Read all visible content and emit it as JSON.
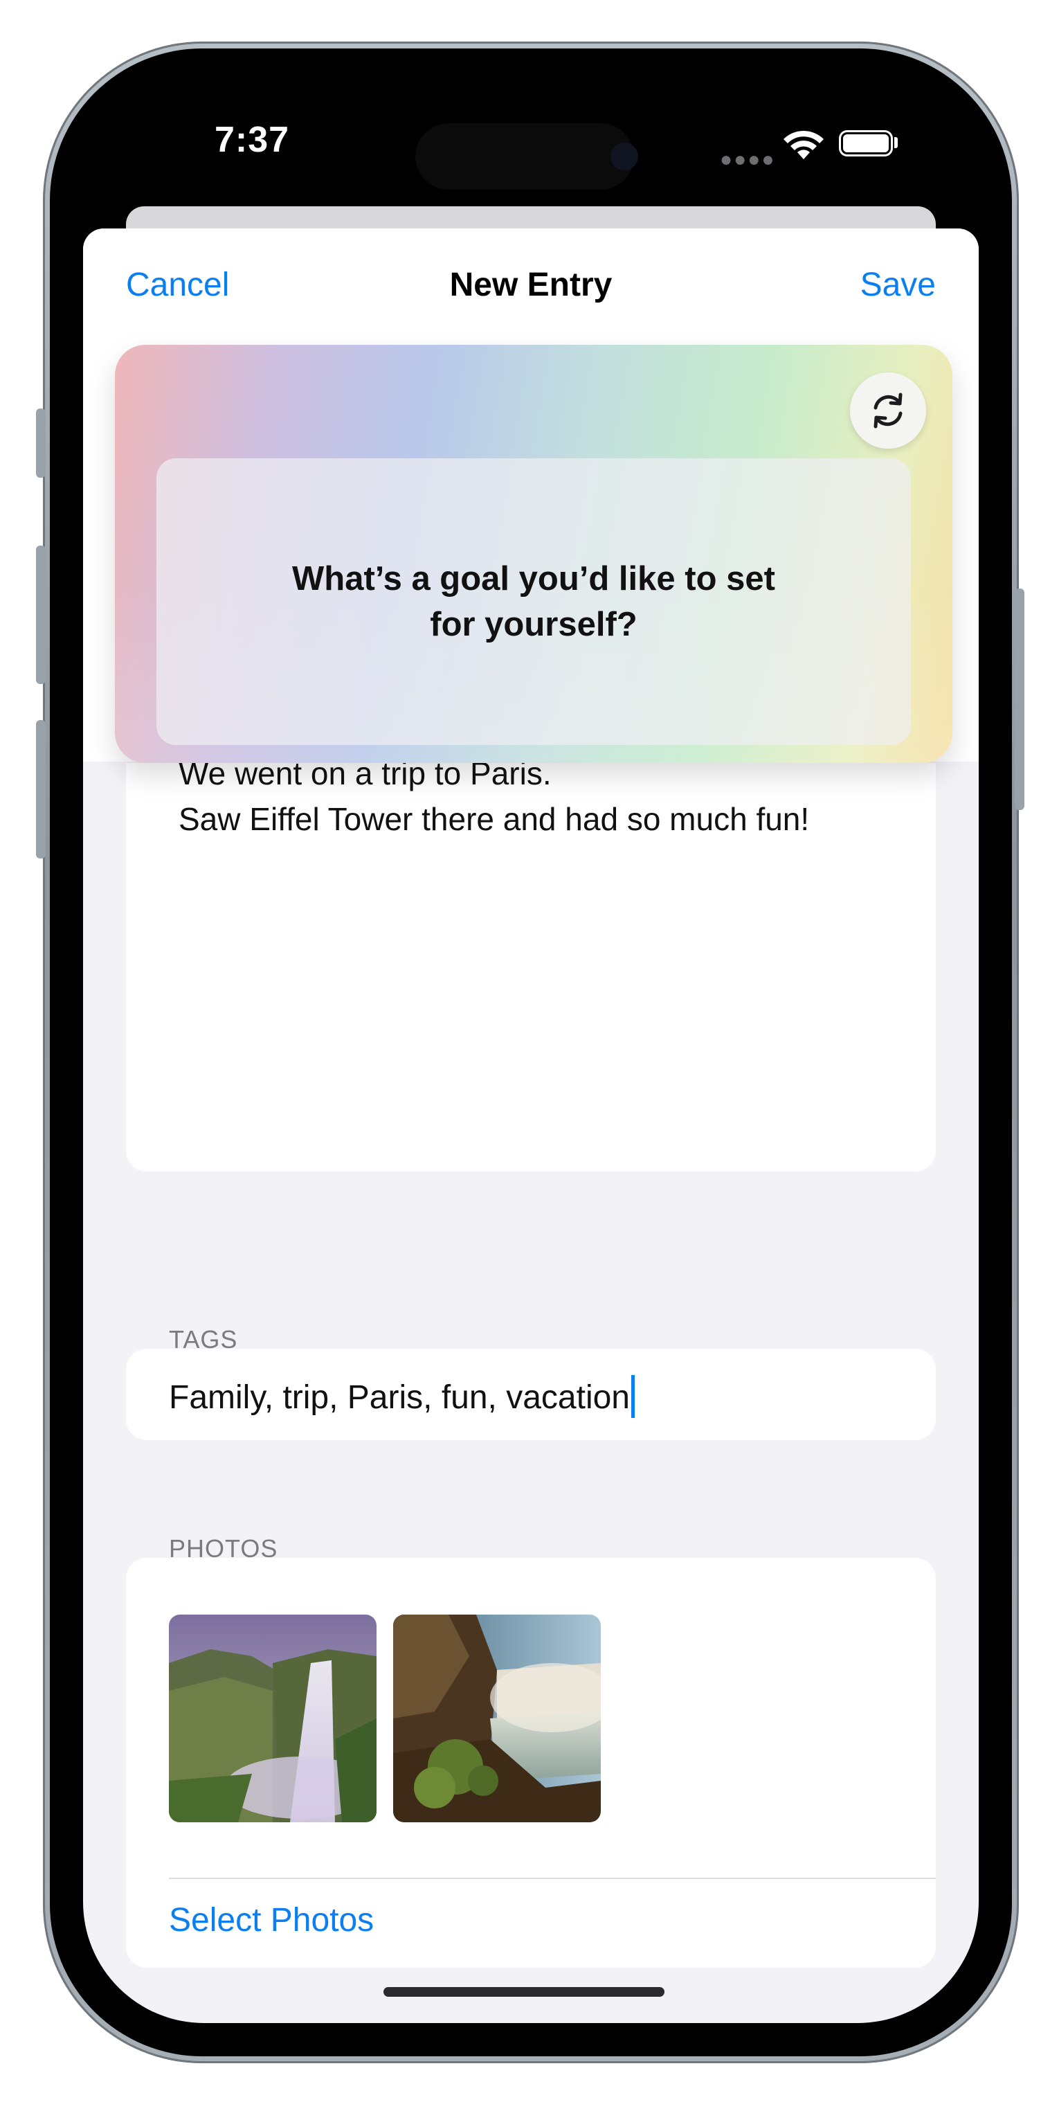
{
  "status_bar": {
    "time": "7:37",
    "signal_icon": "cellular-dots-icon",
    "wifi_icon": "wifi-icon",
    "battery_icon": "battery-icon",
    "battery_level": 1.0
  },
  "nav": {
    "cancel_label": "Cancel",
    "title": "New Entry",
    "save_label": "Save"
  },
  "prompt": {
    "text": "What’s a goal you’d like to set for yourself?",
    "refresh_icon": "refresh-icon"
  },
  "entry": {
    "body": "We went on a trip to Paris.\nSaw Eiffel Tower there and had so much fun!"
  },
  "tags": {
    "label": "TAGS",
    "value": "Family, trip, Paris, fun, vacation"
  },
  "photos": {
    "label": "PHOTOS",
    "items": [
      {
        "icon": "waterfall-photo-thumbnail"
      },
      {
        "icon": "waterfall-photo-thumbnail"
      }
    ],
    "select_label": "Select Photos"
  },
  "colors": {
    "accent": "#0b7ef0",
    "background": "#f2f2f7",
    "secondary_label": "#7a7a7f"
  }
}
